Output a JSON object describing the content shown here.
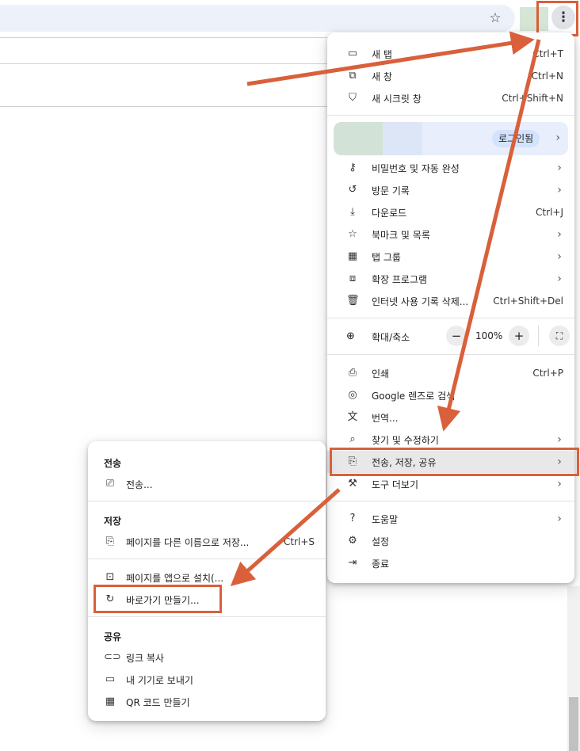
{
  "browser": {
    "star_icon": "☆",
    "menu_icon": "⋮"
  },
  "main_menu": {
    "items_top": [
      {
        "icon": "▭",
        "label": "새 탭",
        "shortcut": "Ctrl+T"
      },
      {
        "icon": "⧉",
        "label": "새 창",
        "shortcut": "Ctrl+N"
      },
      {
        "icon": "⛉",
        "label": "새 시크릿 창",
        "shortcut": "Ctrl+Shift+N"
      }
    ],
    "profile_status": "로그인됨",
    "items_mid": [
      {
        "icon": "⚷",
        "label": "비밀번호 및 자동 완성",
        "shortcut": "",
        "arrow": "›"
      },
      {
        "icon": "↺",
        "label": "방문 기록",
        "shortcut": "",
        "arrow": "›"
      },
      {
        "icon": "⤓",
        "label": "다운로드",
        "shortcut": "Ctrl+J",
        "arrow": ""
      },
      {
        "icon": "☆",
        "label": "북마크 및 목록",
        "shortcut": "",
        "arrow": "›"
      },
      {
        "icon": "▦",
        "label": "탭 그룹",
        "shortcut": "",
        "arrow": "›"
      },
      {
        "icon": "⧈",
        "label": "확장 프로그램",
        "shortcut": "",
        "arrow": "›"
      },
      {
        "icon": "🗑",
        "label": "인터넷 사용 기록 삭제...",
        "shortcut": "Ctrl+Shift+Del",
        "arrow": ""
      }
    ],
    "zoom": {
      "label": "확대/축소",
      "value": "100%",
      "minus": "−",
      "plus": "+",
      "icon": "⊕",
      "fullscreen": "⛶"
    },
    "items_tools": [
      {
        "icon": "⎙",
        "label": "인쇄",
        "shortcut": "Ctrl+P",
        "arrow": ""
      },
      {
        "icon": "◎",
        "label": "Google 렌즈로 검색",
        "shortcut": "",
        "arrow": ""
      },
      {
        "icon": "文",
        "label": "번역...",
        "shortcut": "",
        "arrow": ""
      },
      {
        "icon": "⌕",
        "label": "찾기 및 수정하기",
        "shortcut": "",
        "arrow": "›"
      },
      {
        "icon": "⎘",
        "label": "전송, 저장, 공유",
        "shortcut": "",
        "arrow": "›"
      },
      {
        "icon": "⚒",
        "label": "도구 더보기",
        "shortcut": "",
        "arrow": "›"
      }
    ],
    "items_bottom": [
      {
        "icon": "?",
        "label": "도움말",
        "shortcut": "",
        "arrow": "›"
      },
      {
        "icon": "⚙",
        "label": "설정",
        "shortcut": "",
        "arrow": ""
      },
      {
        "icon": "⇥",
        "label": "종료",
        "shortcut": "",
        "arrow": ""
      }
    ]
  },
  "sub_menu": {
    "send_header": "전송",
    "cast": {
      "icon": "⎚",
      "label": "전송..."
    },
    "save_header": "저장",
    "save_page": {
      "icon": "⎘",
      "label": "페이지를 다른 이름으로 저장...",
      "shortcut": "Ctrl+S"
    },
    "install_app": {
      "icon": "⊡",
      "label": "페이지를 앱으로 설치(..."
    },
    "create_shortcut": {
      "icon": "↻",
      "label": "바로가기 만들기..."
    },
    "share_header": "공유",
    "copy_link": {
      "icon": "⊂⊃",
      "label": "링크 복사"
    },
    "send_device": {
      "icon": "▭",
      "label": "내 기기로 보내기"
    },
    "qr_code": {
      "icon": "▦",
      "label": "QR 코드 만들기"
    }
  },
  "colors": {
    "annotation": "#d9603a",
    "menu_bg": "#ffffff",
    "address_bar": "#edf2fa"
  }
}
